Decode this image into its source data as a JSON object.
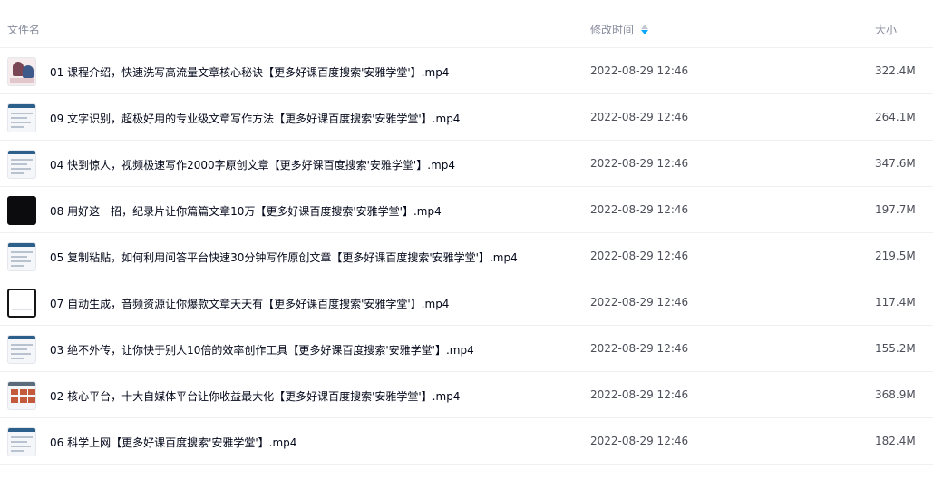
{
  "header": {
    "name_label": "文件名",
    "time_label": "修改时间",
    "size_label": "大小"
  },
  "accent_color": "#06a7ff",
  "files": [
    {
      "name": "01 课程介绍，快速洗写高流量文章核心秘诀【更多好课百度搜索'安雅学堂'】.mp4",
      "time": "2022-08-29 12:46",
      "size": "322.4M",
      "thumb": "people"
    },
    {
      "name": "09 文字识别，超极好用的专业级文章写作方法【更多好课百度搜索'安雅学堂'】.mp4",
      "time": "2022-08-29 12:46",
      "size": "264.1M",
      "thumb": "doc"
    },
    {
      "name": "04 快到惊人，视频极速写作2000字原创文章【更多好课百度搜索'安雅学堂'】.mp4",
      "time": "2022-08-29 12:46",
      "size": "347.6M",
      "thumb": "doc"
    },
    {
      "name": "08 用好这一招，纪录片让你篇篇文章10万【更多好课百度搜索'安雅学堂'】.mp4",
      "time": "2022-08-29 12:46",
      "size": "197.7M",
      "thumb": "dark"
    },
    {
      "name": "05 复制粘贴，如何利用问答平台快速30分钟写作原创文章【更多好课百度搜索'安雅学堂'】.mp4",
      "time": "2022-08-29 12:46",
      "size": "219.5M",
      "thumb": "doc"
    },
    {
      "name": "07 自动生成，音频资源让你爆款文章天天有【更多好课百度搜索'安雅学堂'】.mp4",
      "time": "2022-08-29 12:46",
      "size": "117.4M",
      "thumb": "screen"
    },
    {
      "name": "03 绝不外传，让你快于别人10倍的效率创作工具【更多好课百度搜索'安雅学堂'】.mp4",
      "time": "2022-08-29 12:46",
      "size": "155.2M",
      "thumb": "doc"
    },
    {
      "name": "02 核心平台，十大自媒体平台让你收益最大化【更多好课百度搜索'安雅学堂'】.mp4",
      "time": "2022-08-29 12:46",
      "size": "368.9M",
      "thumb": "grid"
    },
    {
      "name": "06 科学上网【更多好课百度搜索'安雅学堂'】.mp4",
      "time": "2022-08-29 12:46",
      "size": "182.4M",
      "thumb": "doc"
    }
  ]
}
